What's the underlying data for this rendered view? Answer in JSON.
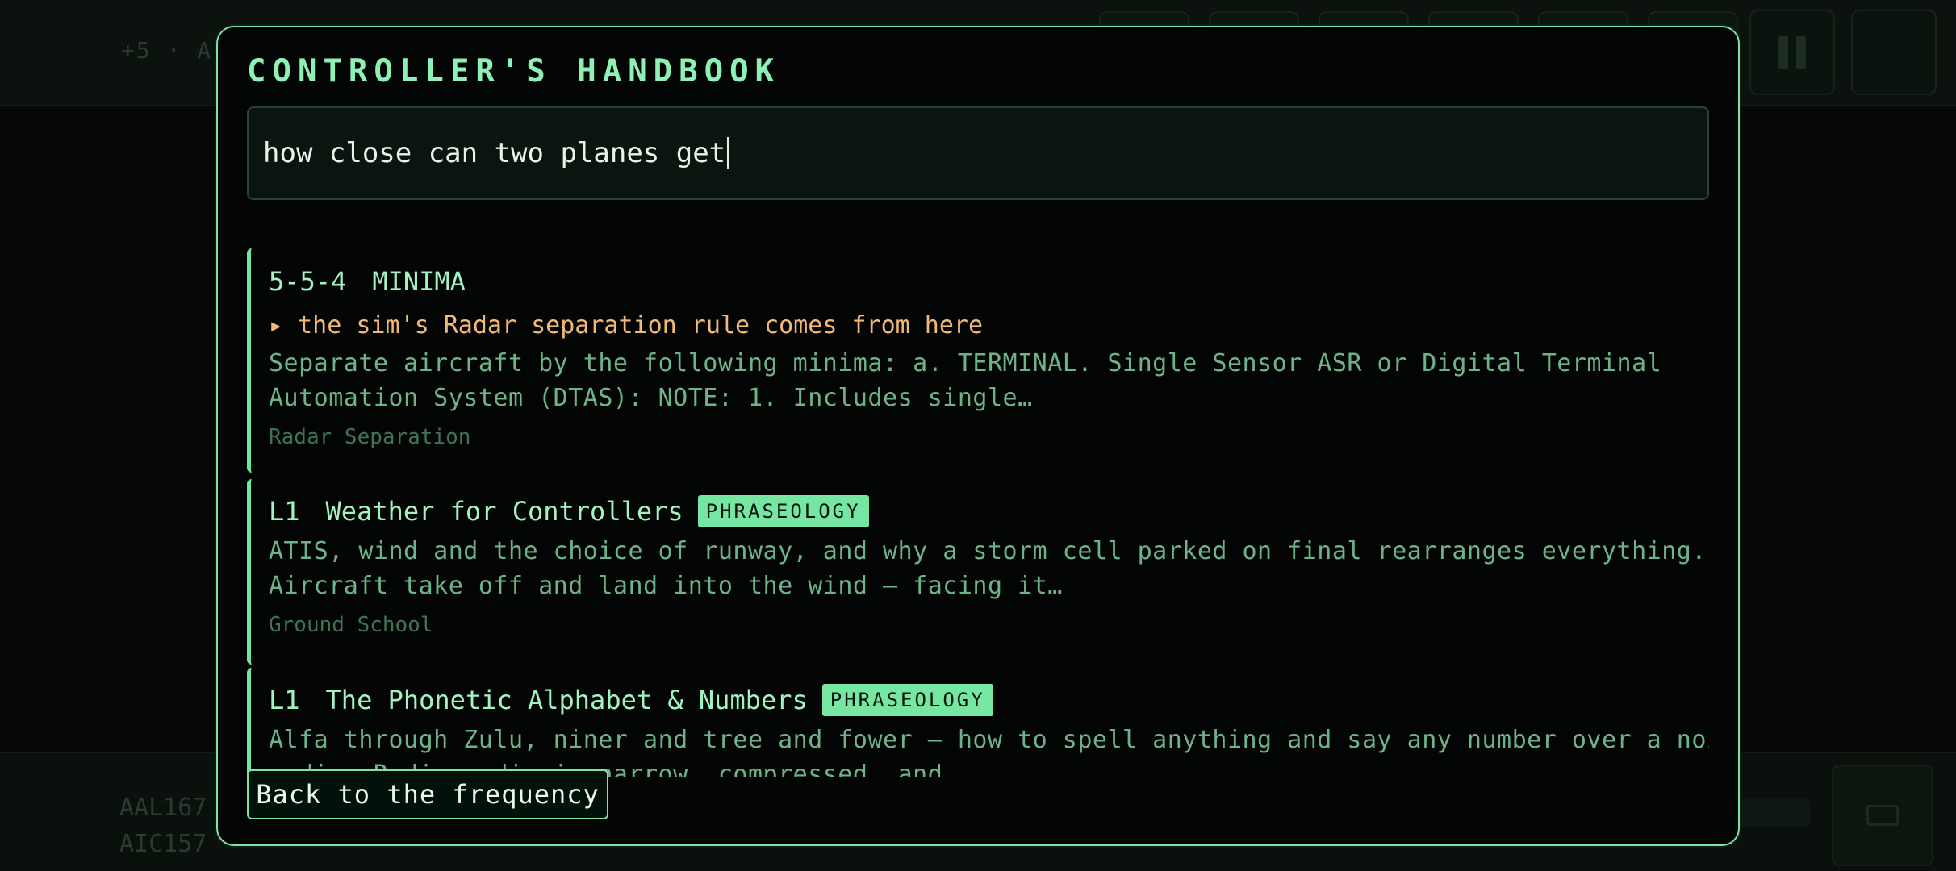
{
  "background": {
    "topbar": {
      "lead_text": "+5 · A"
    },
    "bottom_strips": [
      "AAL167",
      "AIC157"
    ]
  },
  "handbook": {
    "title": "CONTROLLER'S HANDBOOK",
    "search_value": "how close can two planes get",
    "results": [
      {
        "code": "5-5-4",
        "title": "MINIMA",
        "badge": "",
        "note": "▸ the sim's Radar separation rule comes from here",
        "body_lines": [
          "Separate aircraft by the following minima: a. TERMINAL. Single Sensor ASR or Digital Terminal",
          "Automation System (DTAS): NOTE: 1. Includes single…"
        ],
        "category": "Radar Separation"
      },
      {
        "code": "L1",
        "title": "Weather for Controllers",
        "badge": "PHRASEOLOGY",
        "body_lines": [
          "ATIS, wind and the choice of runway, and why a storm cell parked on final rearranges everything.",
          "Aircraft take off and land into the wind — facing it…"
        ],
        "category": "Ground School"
      },
      {
        "code": "L1",
        "title": "The Phonetic Alphabet & Numbers",
        "badge": "PHRASEOLOGY",
        "body_lines": [
          "Alfa through Zulu, niner and tree and fower — how to spell anything and say any number over a noisy",
          "radio. Radio audio is narrow, compressed, and…"
        ]
      }
    ],
    "back_button": "Back to the frequency"
  },
  "colors": {
    "accent": "#7ee2a5",
    "note": "#efb97a",
    "badge_bg": "#76e7a3"
  }
}
